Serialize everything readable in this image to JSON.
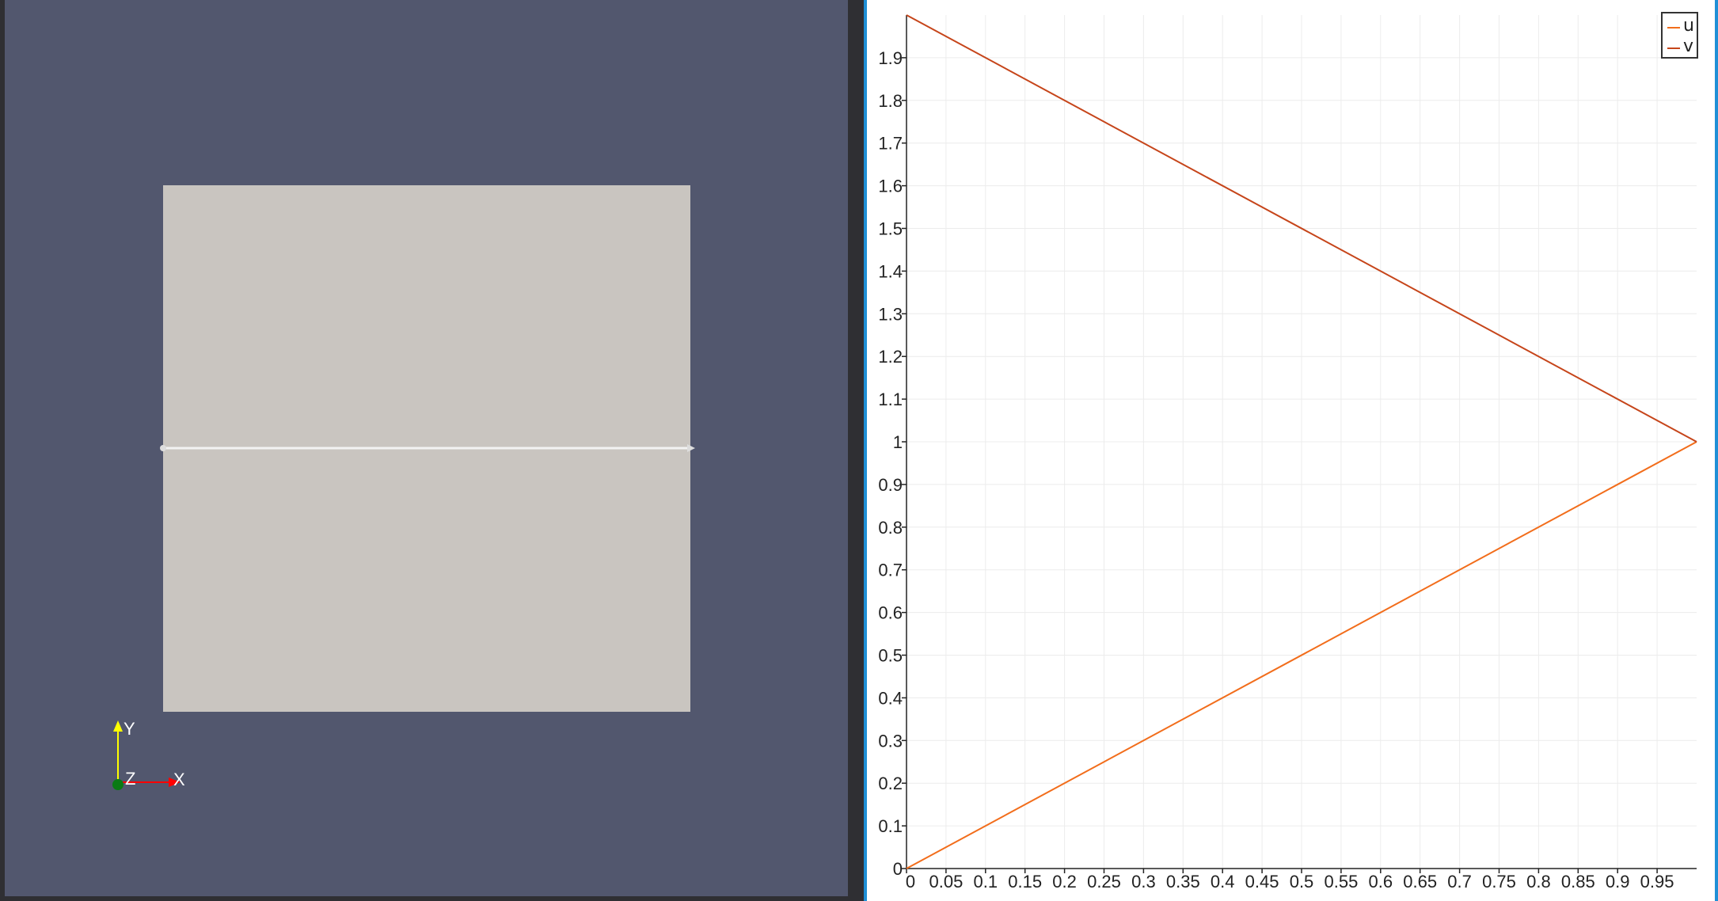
{
  "render_view": {
    "background": "#52576e",
    "plane_color": "#c9c5c0",
    "line_color": "#f2f2f2",
    "axes": {
      "x_label": "X",
      "y_label": "Y",
      "z_label": "Z"
    }
  },
  "chart_data": {
    "type": "line",
    "title": "",
    "xlabel": "",
    "ylabel": "",
    "xlim": [
      0,
      1
    ],
    "ylim": [
      0,
      2
    ],
    "grid": true,
    "legend_placement": "top-right",
    "x_ticks": [
      "0",
      "0.05",
      "0.1",
      "0.15",
      "0.2",
      "0.25",
      "0.3",
      "0.35",
      "0.4",
      "0.45",
      "0.5",
      "0.55",
      "0.6",
      "0.65",
      "0.7",
      "0.75",
      "0.8",
      "0.85",
      "0.9",
      "0.95"
    ],
    "y_ticks": [
      "0",
      "0.1",
      "0.2",
      "0.3",
      "0.4",
      "0.5",
      "0.6",
      "0.7",
      "0.8",
      "0.9",
      "1",
      "1.1",
      "1.2",
      "1.3",
      "1.4",
      "1.5",
      "1.6",
      "1.7",
      "1.8",
      "1.9"
    ],
    "series": [
      {
        "name": "u",
        "color": "#f26d1b",
        "x": [
          0,
          1
        ],
        "y": [
          0,
          1
        ]
      },
      {
        "name": "v",
        "color": "#c6451a",
        "x": [
          0,
          1
        ],
        "y": [
          2,
          1
        ]
      }
    ]
  }
}
